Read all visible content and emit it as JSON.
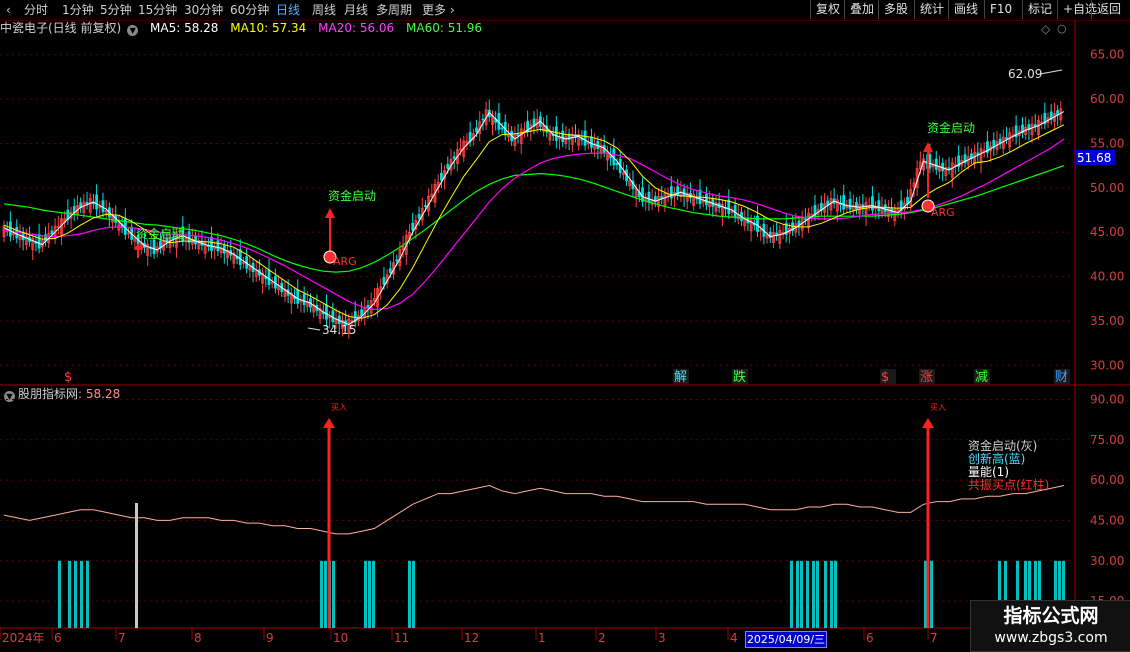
{
  "toolbar": {
    "periods": [
      "分时",
      "1分钟",
      "5分钟",
      "15分钟",
      "30分钟",
      "60分钟",
      "日线",
      "周线",
      "月线",
      "多周期",
      "更多"
    ],
    "active_period": "日线",
    "right_buttons": [
      "复权",
      "叠加",
      "多股",
      "统计",
      "画线",
      "F10",
      "标记",
      "+自选",
      "返回"
    ]
  },
  "main_legend": {
    "title": "中瓷电子(日线 前复权)",
    "ma5": "MA5: 58.28",
    "ma10": "MA10: 57.34",
    "ma20": "MA20: 56.06",
    "ma60": "MA60: 51.96"
  },
  "sub_legend": {
    "title": "股朋指标网",
    "value": ": 58.28"
  },
  "price_axis": [
    "65.00",
    "60.00",
    "55.00",
    "50.00",
    "45.00",
    "40.00",
    "35.00",
    "30.00"
  ],
  "price_tag": "51.68",
  "sub_axis": [
    "90.00",
    "75.00",
    "60.00",
    "45.00",
    "30.00",
    "15.00"
  ],
  "annotations": {
    "high_label": "62.09",
    "low_label": "34.15",
    "signal_1": "资金启动",
    "signal_2": "资金启动",
    "signal_3": "资金启动",
    "marker_1": "ARG",
    "marker_2": "ARG",
    "sub_tag_1": "买入",
    "sub_tag_2": "买入"
  },
  "event_marks": [
    {
      "text": "$",
      "color": "#ff4040"
    },
    {
      "text": "解",
      "color": "#40e0ff"
    },
    {
      "text": "跌",
      "color": "#40ff40"
    },
    {
      "text": "$",
      "color": "#ff4040"
    },
    {
      "text": "涨",
      "color": "#ff4040"
    },
    {
      "text": "减",
      "color": "#40ff40"
    },
    {
      "text": "财",
      "color": "#40a0ff"
    }
  ],
  "sub_legend_box": {
    "line1": "资金启动(灰)",
    "line2": "创新高(蓝)",
    "line3": "量能(1)",
    "line4": "共振买点(红柱)"
  },
  "date_axis": [
    "2024年",
    "6",
    "7",
    "8",
    "9",
    "10",
    "11",
    "12",
    "1",
    "2",
    "3",
    "4",
    "6",
    "7"
  ],
  "date_highlight": "2025/04/09/三",
  "watermark": {
    "line1": "指标公式网",
    "line2": "www.zbgs3.com"
  },
  "colors": {
    "ma5": "#ffffff",
    "ma10": "#ffff00",
    "ma20": "#ff00ff",
    "ma60": "#00ff00",
    "signal": "#ff2020",
    "bar": "#00c0c0"
  },
  "chart_data": {
    "type": "line",
    "title": "中瓷电子(日线 前复权)",
    "ylim": [
      28,
      67
    ],
    "ticks_y": [
      30,
      35,
      40,
      45,
      50,
      55,
      60,
      65
    ],
    "x_months": [
      "2024年",
      "6",
      "7",
      "8",
      "9",
      "10",
      "11",
      "12",
      "1",
      "2",
      "3",
      "4",
      "6",
      "7"
    ],
    "close": [
      45.5,
      44.8,
      44.2,
      43.6,
      45.0,
      46.5,
      47.8,
      48.4,
      47.6,
      46.2,
      44.8,
      43.5,
      43.0,
      44.0,
      44.6,
      44.0,
      43.5,
      43.2,
      42.5,
      41.5,
      40.5,
      39.5,
      38.5,
      37.5,
      37.0,
      36.0,
      35.2,
      34.6,
      35.5,
      37.0,
      39.5,
      42.0,
      45.0,
      47.5,
      50.0,
      52.5,
      54.5,
      56.0,
      58.5,
      57.0,
      55.5,
      56.5,
      57.5,
      56.0,
      55.5,
      55.8,
      55.0,
      54.5,
      53.0,
      51.0,
      49.0,
      48.5,
      49.0,
      49.5,
      49.0,
      48.5,
      48.0,
      47.5,
      46.5,
      45.8,
      44.5,
      44.8,
      45.5,
      46.5,
      47.5,
      48.5,
      48.0,
      47.8,
      48.0,
      47.6,
      47.2,
      48.5,
      53.0,
      52.5,
      52.0,
      52.8,
      53.5,
      54.2,
      55.0,
      55.8,
      56.5,
      57.0,
      57.8,
      58.6
    ],
    "ma5": [
      45.8,
      45.2,
      44.7,
      44.2,
      44.3,
      44.9,
      45.8,
      46.6,
      47.0,
      46.9,
      46.2,
      45.3,
      44.3,
      43.8,
      44.0,
      44.0,
      43.9,
      43.7,
      43.3,
      42.5,
      41.5,
      40.5,
      39.5,
      38.5,
      37.8,
      37.0,
      36.2,
      35.5,
      35.3,
      35.7,
      36.8,
      38.6,
      41.0,
      43.7,
      46.4,
      48.9,
      51.3,
      53.2,
      55.2,
      56.0,
      56.1,
      56.3,
      56.6,
      56.3,
      56.0,
      55.9,
      55.7,
      55.3,
      54.5,
      53.1,
      51.3,
      50.0,
      49.3,
      49.1,
      49.0,
      48.9,
      48.7,
      48.4,
      47.9,
      47.2,
      46.4,
      45.9,
      45.6,
      45.6,
      46.0,
      46.6,
      47.2,
      47.6,
      47.8,
      47.8,
      47.7,
      47.8,
      49.0,
      49.9,
      50.6,
      51.8,
      52.8,
      53.0,
      53.5,
      54.2,
      55.0,
      55.7,
      56.4,
      57.1
    ],
    "ma20": [
      45.2,
      45.0,
      44.8,
      44.6,
      44.5,
      44.6,
      44.8,
      45.2,
      45.5,
      45.6,
      45.5,
      45.3,
      45.0,
      44.8,
      44.7,
      44.6,
      44.4,
      44.1,
      43.7,
      43.2,
      42.6,
      41.9,
      41.2,
      40.4,
      39.6,
      38.8,
      38.0,
      37.2,
      36.6,
      36.3,
      36.4,
      37.0,
      38.0,
      39.5,
      41.2,
      43.0,
      44.8,
      46.6,
      48.4,
      49.9,
      51.1,
      52.0,
      52.8,
      53.3,
      53.6,
      53.8,
      53.9,
      53.9,
      53.7,
      53.3,
      52.6,
      51.8,
      51.0,
      50.3,
      49.8,
      49.4,
      49.1,
      48.9,
      48.6,
      48.2,
      47.7,
      47.2,
      46.8,
      46.6,
      46.5,
      46.5,
      46.6,
      46.8,
      47.0,
      47.1,
      47.2,
      47.3,
      47.6,
      48.0,
      48.5,
      49.1,
      49.8,
      50.5,
      51.3,
      52.1,
      52.9,
      53.7,
      54.5,
      55.5
    ],
    "ma60": [
      48.2,
      48.0,
      47.8,
      47.5,
      47.3,
      47.1,
      46.9,
      46.7,
      46.5,
      46.3,
      46.1,
      45.9,
      45.8,
      45.6,
      45.4,
      45.2,
      44.9,
      44.6,
      44.2,
      43.7,
      43.1,
      42.4,
      41.8,
      41.3,
      40.9,
      40.6,
      40.5,
      40.6,
      41.0,
      41.6,
      42.4,
      43.3,
      44.3,
      45.3,
      46.4,
      47.5,
      48.6,
      49.6,
      50.4,
      51.0,
      51.4,
      51.5,
      51.6,
      51.5,
      51.3,
      51.0,
      50.6,
      50.1,
      49.6,
      49.1,
      48.6,
      48.2,
      47.8,
      47.5,
      47.2,
      47.0,
      46.8,
      46.7,
      46.6,
      46.5,
      46.5,
      46.5,
      46.6,
      46.7,
      46.8,
      46.8,
      46.8,
      46.8,
      46.8,
      46.9,
      47.0,
      47.2,
      47.5,
      47.8,
      48.2,
      48.6,
      49.0,
      49.5,
      50.0,
      50.5,
      51.0,
      51.5,
      52.0,
      52.5
    ],
    "sub_line": [
      47,
      46,
      45,
      46,
      47,
      48,
      49,
      49,
      48,
      47,
      46,
      46,
      45,
      45,
      46,
      46,
      46,
      45,
      45,
      44,
      44,
      43,
      43,
      42,
      42,
      41,
      40,
      40,
      41,
      42,
      45,
      48,
      51,
      53,
      55,
      55,
      56,
      57,
      58,
      56,
      55,
      56,
      57,
      56,
      55,
      55,
      55,
      54,
      54,
      53,
      52,
      52,
      52,
      52,
      52,
      51,
      51,
      51,
      51,
      50,
      49,
      49,
      49,
      50,
      50,
      51,
      51,
      50,
      50,
      49,
      48,
      48,
      51,
      52,
      52,
      53,
      53,
      54,
      54,
      55,
      55,
      56,
      57,
      58
    ]
  }
}
